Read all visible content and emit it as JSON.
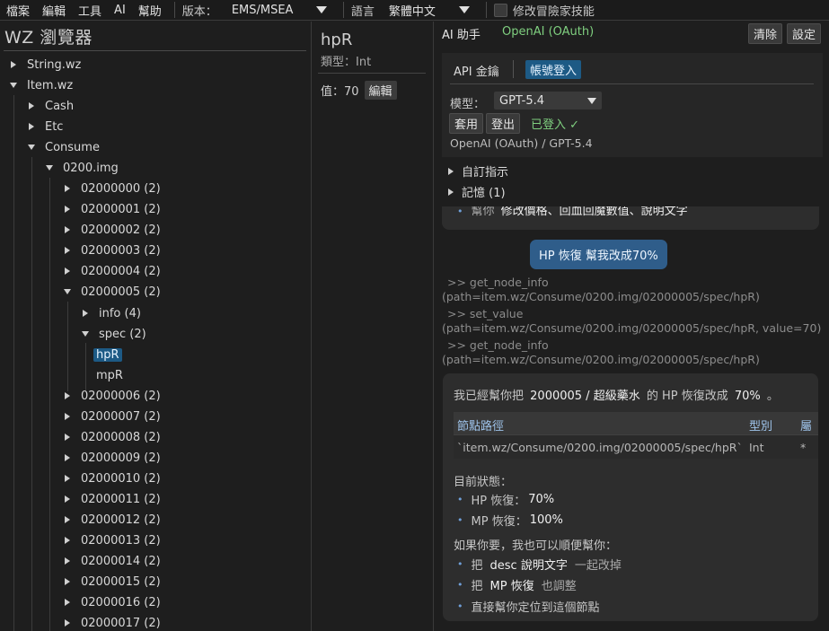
{
  "menubar": {
    "file": "檔案",
    "edit": "編輯",
    "tools": "工具",
    "ai": "AI",
    "help": "幫助",
    "version_label": "版本：",
    "version_value": "EMS/MSEA",
    "language_label": "語言",
    "language_value": "繁體中文",
    "modify_skill_label": "修改冒險家技能"
  },
  "tree": {
    "title": "WZ 瀏覽器",
    "nodes": [
      {
        "label": "String.wz",
        "expanded": false
      },
      {
        "label": "Item.wz",
        "expanded": true
      },
      {
        "label": "Cash",
        "expanded": false
      },
      {
        "label": "Etc",
        "expanded": false
      },
      {
        "label": "Consume",
        "expanded": true
      },
      {
        "label": "0200.img",
        "expanded": true
      },
      {
        "label": "02000000 (2)"
      },
      {
        "label": "02000001 (2)"
      },
      {
        "label": "02000002 (2)"
      },
      {
        "label": "02000003 (2)"
      },
      {
        "label": "02000004 (2)"
      },
      {
        "label": "02000005 (2)",
        "expanded": true
      },
      {
        "label": "info (4)"
      },
      {
        "label": "spec (2)",
        "expanded": true
      },
      {
        "label": "hpR",
        "selected": true
      },
      {
        "label": "mpR"
      },
      {
        "label": "02000006 (2)"
      },
      {
        "label": "02000007 (2)"
      },
      {
        "label": "02000008 (2)"
      },
      {
        "label": "02000009 (2)"
      },
      {
        "label": "02000010 (2)"
      },
      {
        "label": "02000011 (2)"
      },
      {
        "label": "02000012 (2)"
      },
      {
        "label": "02000013 (2)"
      },
      {
        "label": "02000014 (2)"
      },
      {
        "label": "02000015 (2)"
      },
      {
        "label": "02000016 (2)"
      },
      {
        "label": "02000017 (2)"
      }
    ]
  },
  "node": {
    "name": "hpR",
    "type_text": "類型：Int",
    "value_text": "值：70",
    "edit_label": "編輯"
  },
  "assistant": {
    "tab_label": "AI 助手",
    "provider": "OpenAI (OAuth)",
    "clear_label": "清除",
    "settings_label": "設定",
    "auth": {
      "api_key_tab": "API 金鑰",
      "account_tab": "帳號登入",
      "model_label": "模型：",
      "model_value": "GPT-5.4",
      "apply_label": "套用",
      "logout_label": "登出",
      "status": "已登入 ✓",
      "summary": "OpenAI (OAuth) / GPT-5.4"
    },
    "custom_instructions": "自訂指示",
    "memory": "記憶 (1)",
    "chat": {
      "prev_bubble_bullet_prefix": "幫你",
      "prev_bubble_bullet_rest": "修改價格、回血回魔數值、說明文字",
      "user_message": "HP 恢復 幫我改成70%",
      "tool_calls": [
        ">> get_node_info",
        "(path=item.wz/Consume/0200.img/02000005/spec/hpR)",
        ">> set_value",
        "(path=item.wz/Consume/0200.img/02000005/spec/hpR, value=70)",
        ">> get_node_info",
        "(path=item.wz/Consume/0200.img/02000005/spec/hpR)"
      ],
      "reply": {
        "intro_a": "我已經幫你把",
        "intro_item": "2000005 / 超級藥水",
        "intro_b": "的 HP 恢復改成",
        "intro_value": "70%",
        "intro_end": "。",
        "table_headers": [
          "節點路徑",
          "型別",
          "屬"
        ],
        "table_row": [
          "`item.wz/Consume/0200.img/02000005/spec/hpR`",
          "Int",
          "*"
        ],
        "status_title": "目前狀態：",
        "status_hp_label": "HP 恢復：",
        "status_hp_value": "70%",
        "status_mp_label": "MP 恢復：",
        "status_mp_value": "100%",
        "offer_title": "如果你要，我也可以順便幫你：",
        "offer_1_a": "把",
        "offer_1_hl": "desc 說明文字",
        "offer_1_b": "一起改掉",
        "offer_2_a": "把",
        "offer_2_hl": "MP 恢復",
        "offer_2_b": "也調整",
        "offer_3": "直接幫你定位到這個節點"
      }
    }
  },
  "colors": {
    "accent_blue": "#1d5a85",
    "status_green": "#7fcf7f",
    "user_bubble": "#2f5d8a"
  }
}
